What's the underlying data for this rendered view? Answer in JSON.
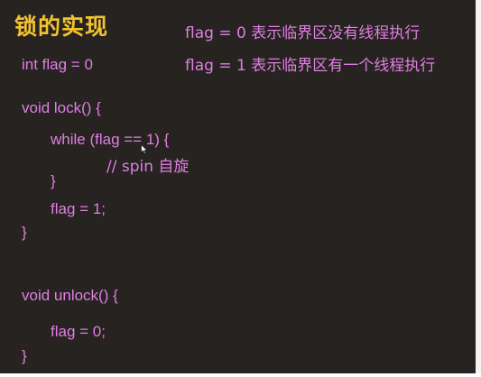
{
  "slide": {
    "title": "锁的实现",
    "notes": [
      "flag = 0 表示临界区没有线程执行",
      "flag = 1 表示临界区有一个线程执行"
    ],
    "code_lines": [
      "int flag = 0",
      "void lock() {",
      "while (flag == 1) {",
      "// spin 自旋",
      "}",
      "flag = 1;",
      "}",
      "void unlock() {",
      "flag = 0;",
      "}"
    ]
  },
  "colors": {
    "background": "#262320",
    "title": "#f2c230",
    "text": "#e07fe2"
  },
  "icons": {
    "cursor": "mouse-pointer-icon"
  }
}
